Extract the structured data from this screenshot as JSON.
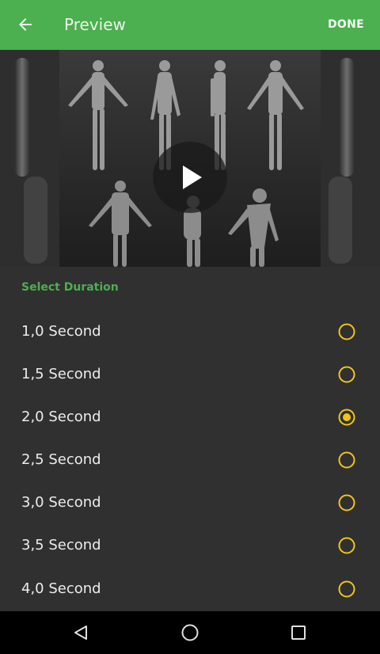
{
  "appbar": {
    "back_icon": "arrow-back-icon",
    "title": "Preview",
    "done_label": "DONE",
    "color": "#4caf50"
  },
  "preview": {
    "play_icon": "play-icon"
  },
  "duration": {
    "section_label": "Select Duration",
    "accent": "#f0c419",
    "options": [
      {
        "label": "1,0 Second",
        "selected": false
      },
      {
        "label": "1,5 Second",
        "selected": false
      },
      {
        "label": "2,0 Second",
        "selected": true
      },
      {
        "label": "2,5 Second",
        "selected": false
      },
      {
        "label": "3,0 Second",
        "selected": false
      },
      {
        "label": "3,5 Second",
        "selected": false
      },
      {
        "label": "4,0 Second",
        "selected": false
      }
    ]
  },
  "navbar": {
    "back_icon": "nav-back-icon",
    "home_icon": "nav-home-icon",
    "recents_icon": "nav-recents-icon"
  }
}
